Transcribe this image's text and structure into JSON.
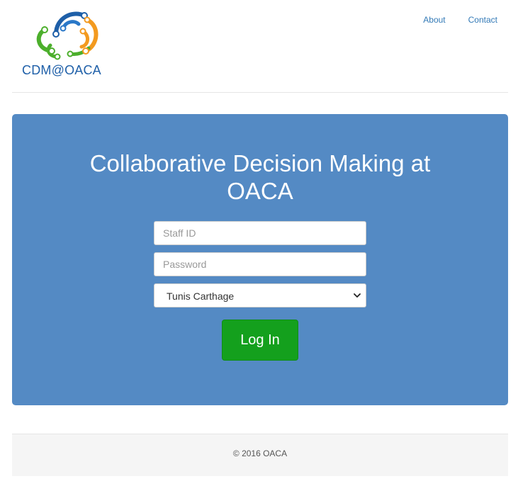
{
  "header": {
    "logo_text": "CDM@OACA",
    "nav": [
      {
        "label": "About"
      },
      {
        "label": "Contact"
      }
    ]
  },
  "login": {
    "title": "Collaborative Decision Making at OACA",
    "staff_id_placeholder": "Staff ID",
    "staff_id_value": "",
    "password_placeholder": "Password",
    "password_value": "",
    "airport_selected": "Tunis Carthage",
    "submit_label": "Log In"
  },
  "footer": {
    "copyright": "© 2016 OACA"
  },
  "colors": {
    "jumbotron": "#548ac4",
    "button": "#14a01d",
    "link": "#337ab7",
    "logo_blue": "#1e5fa8",
    "logo_green": "#4caf2c",
    "logo_orange": "#f39a1f"
  }
}
